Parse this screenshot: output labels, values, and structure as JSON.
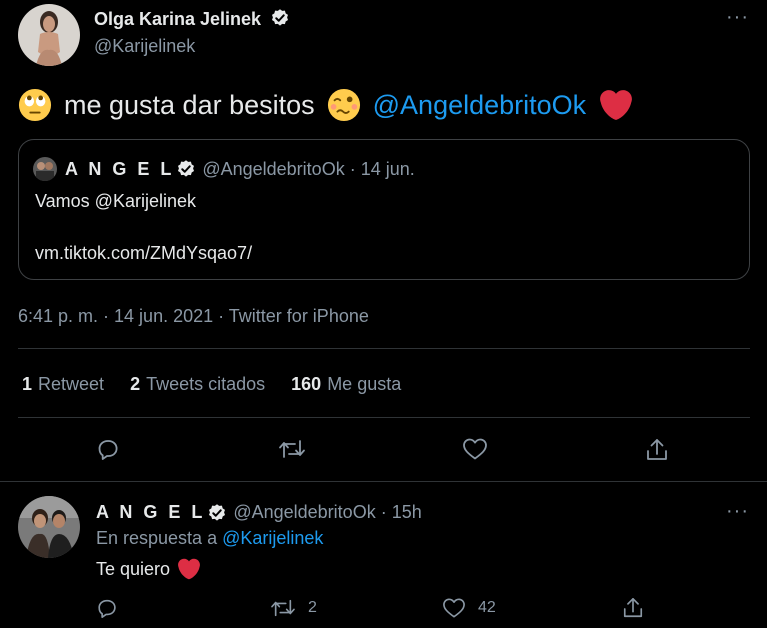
{
  "tweet": {
    "author_name": "Olga Karina Jelinek",
    "author_handle": "@Karijelinek",
    "more_label": "···",
    "text": "me gusta dar besitos",
    "mention": "@AngeldebritoOk",
    "emojis": [
      "rolling-eyes-emoji",
      "woozy-face-emoji",
      "red-heart-emoji"
    ],
    "timestamp": "6:41 p. m. · 14 jun. 2021 · Twitter for iPhone"
  },
  "quote": {
    "name": "A N G E L",
    "handle_date": "@AngeldebritoOk · 14 jun.",
    "line1": "Vamos @Karijelinek",
    "line2": "vm.tiktok.com/ZMdYsqao7/"
  },
  "stats": {
    "retweets_count": "1",
    "retweets_label": "Retweet",
    "quotes_count": "2",
    "quotes_label": "Tweets citados",
    "likes_count": "160",
    "likes_label": "Me gusta"
  },
  "reply": {
    "name": "A N G E L",
    "handle_time": "@AngeldebritoOk · 15h",
    "more_label": "···",
    "reply_to_prefix": "En respuesta a",
    "reply_to_handle": "@Karijelinek",
    "text": "Te quiero",
    "retweet_count": "2",
    "like_count": "42"
  },
  "colors": {
    "background": "#000000",
    "accent": "#1d9bf0",
    "heart": "#e0245e",
    "muted": "#8b98a5"
  }
}
